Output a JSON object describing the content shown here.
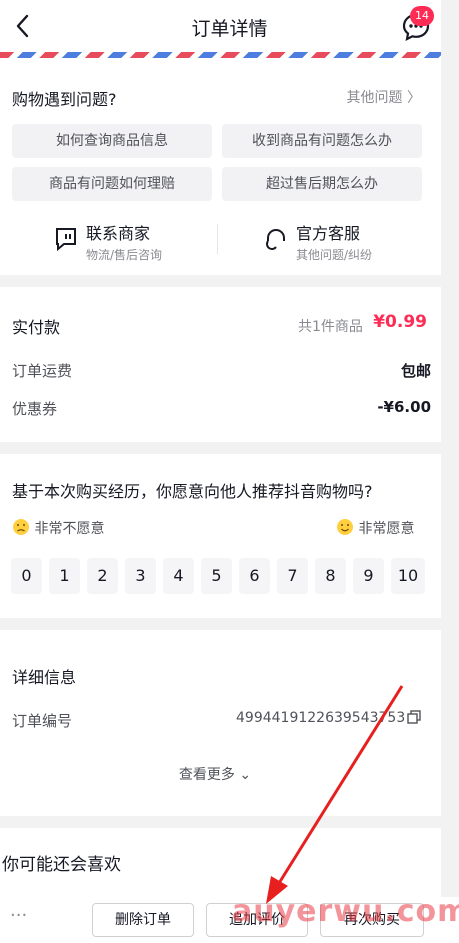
{
  "header": {
    "title": "订单详情",
    "badge_count": "14"
  },
  "help": {
    "title": "购物遇到问题?",
    "other": "其他问题 〉",
    "questions": [
      "如何查询商品信息",
      "收到商品有问题怎么办",
      "商品有问题如何理赔",
      "超过售后期怎么办"
    ],
    "merchant": {
      "title": "联系商家",
      "sub": "物流/售后咨询"
    },
    "official": {
      "title": "官方客服",
      "sub": "其他问题/纠纷"
    }
  },
  "payment": {
    "paid_label": "实付款",
    "items_count": "共1件商品",
    "amount": "¥0.99",
    "shipping_label": "订单运费",
    "shipping_value": "包邮",
    "coupon_label": "优惠券",
    "coupon_value": "-¥6.00"
  },
  "nps": {
    "question": "基于本次购买经历，你愿意向他人推荐抖音购物吗?",
    "low_label": "非常不愿意",
    "high_label": "非常愿意",
    "scores": [
      "0",
      "1",
      "2",
      "3",
      "4",
      "5",
      "6",
      "7",
      "8",
      "9",
      "10"
    ]
  },
  "details": {
    "title": "详细信息",
    "order_label": "订单编号",
    "order_number": "4994419122639543753",
    "more": "查看更多 ⌄"
  },
  "recommend": {
    "title": "你可能还会喜欢"
  },
  "bottom": {
    "more": "···",
    "delete": "删除订单",
    "review": "追加评价",
    "rebuy": "再次购买"
  },
  "watermark": "auyerwu.com",
  "colors": {
    "accent": "#fe2c55",
    "bg": "#f2f2f2"
  }
}
